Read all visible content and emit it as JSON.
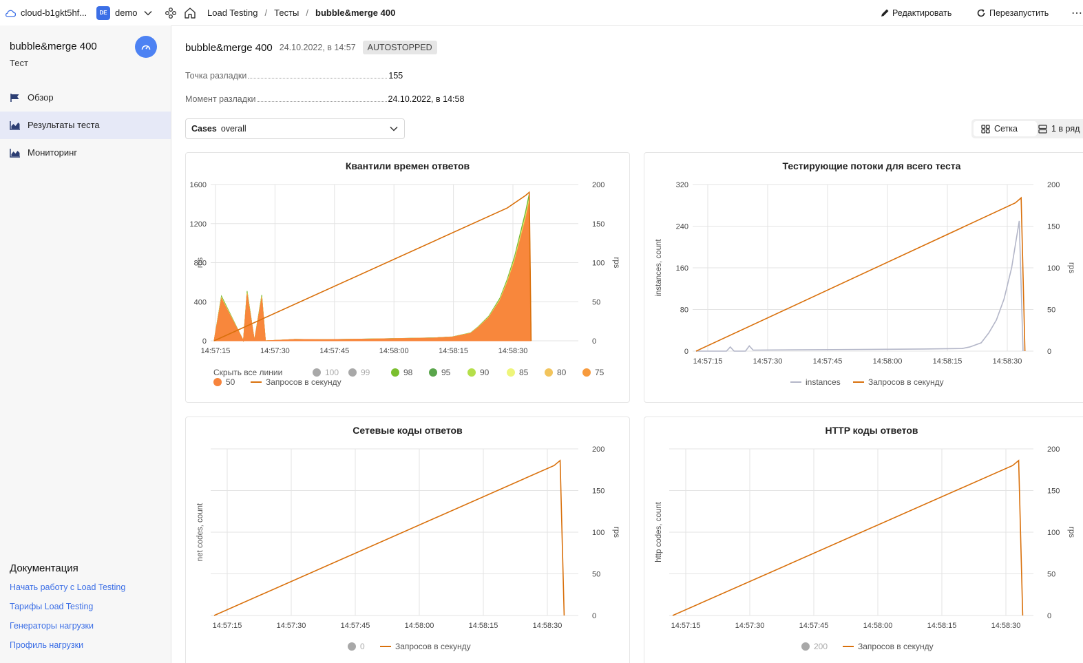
{
  "topbar": {
    "cloud": "cloud-b1gkt5hf...",
    "folder_badge": "DE",
    "folder": "demo",
    "breadcrumbs": [
      "Load Testing",
      "Тесты",
      "bubble&merge 400"
    ],
    "edit_label": "Редактировать",
    "restart_label": "Перезапустить",
    "more_label": "⋯"
  },
  "sidebar": {
    "title": "bubble&merge 400",
    "subtitle": "Тест",
    "items": [
      {
        "label": "Обзор",
        "icon": "flag-icon"
      },
      {
        "label": "Результаты теста",
        "icon": "chart-area-icon",
        "active": true
      },
      {
        "label": "Мониторинг",
        "icon": "chart-mountain-icon"
      }
    ],
    "docs_title": "Документация",
    "docs_links": [
      "Начать работу с Load Testing",
      "Тарифы Load Testing",
      "Генераторы нагрузки",
      "Профиль нагрузки"
    ]
  },
  "test": {
    "name": "bubble&merge 400",
    "date": "24.10.2022, в 14:57",
    "status": "AUTOSTOPPED",
    "fields": [
      {
        "label": "Точка разладки",
        "value": "155"
      },
      {
        "label": "Момент разладки",
        "value": "24.10.2022, в 14:58"
      }
    ]
  },
  "cases": {
    "label": "Cases",
    "value": "overall"
  },
  "view": {
    "grid_label": "Сетка",
    "row_label": "1 в ряд"
  },
  "colors": {
    "rps": "#d9700b",
    "instances": "#b3b6c8",
    "q100": "#a8a8a8",
    "q99": "#a8a8a8",
    "q98": "#7bbf2f",
    "q95": "#5aa54b",
    "q90": "#b5df4a",
    "q85": "#eef57a",
    "q80": "#f2c45c",
    "q75": "#f79a3c",
    "q50": "#f7843c",
    "accent": "#3c6fe6"
  },
  "chart_data": [
    {
      "type": "area",
      "title": "Квантили времен ответов",
      "ylabel": "ms",
      "y2label": "rps",
      "ylim": [
        0,
        1600
      ],
      "y2lim": [
        0,
        200
      ],
      "yticks": [
        "0",
        "400",
        "800",
        "1200",
        "1600"
      ],
      "y2ticks": [
        "0",
        "50",
        "100",
        "150",
        "200"
      ],
      "xticks": [
        "14:57:15",
        "14:57:30",
        "14:57:45",
        "14:58:00",
        "14:58:15",
        "14:58:30"
      ],
      "hide_all_label": "Скрыть все линии",
      "legend": [
        {
          "name": "100",
          "color_key": "q100",
          "muted": true
        },
        {
          "name": "99",
          "color_key": "q99",
          "muted": true
        },
        {
          "name": "98",
          "color_key": "q98"
        },
        {
          "name": "95",
          "color_key": "q95"
        },
        {
          "name": "90",
          "color_key": "q90"
        },
        {
          "name": "85",
          "color_key": "q85"
        },
        {
          "name": "80",
          "color_key": "q80"
        },
        {
          "name": "75",
          "color_key": "q75"
        },
        {
          "name": "50",
          "color_key": "q50"
        },
        {
          "name": "Запросов в секунду",
          "line": true
        }
      ],
      "x_seconds": [
        0,
        2,
        8,
        9,
        11,
        13,
        14,
        20,
        22,
        30,
        45,
        60,
        65,
        70,
        72,
        75,
        78,
        80,
        82,
        84,
        85,
        86,
        86.5
      ],
      "quantile_ms": [
        0,
        450,
        0,
        500,
        0,
        460,
        0,
        10,
        15,
        12,
        20,
        30,
        40,
        80,
        140,
        250,
        430,
        620,
        850,
        1150,
        1300,
        1480,
        0
      ],
      "rps_series": {
        "x_seconds": [
          0,
          80,
          85,
          86,
          86.5
        ],
        "rps": [
          0,
          170,
          186,
          190,
          0
        ]
      }
    },
    {
      "type": "line",
      "title": "Тестирующие потоки для всего теста",
      "ylabel": "instances, count",
      "y2label": "rps",
      "ylim": [
        0,
        320
      ],
      "y2lim": [
        0,
        200
      ],
      "yticks": [
        "0",
        "80",
        "160",
        "240",
        "320"
      ],
      "y2ticks": [
        "0",
        "50",
        "100",
        "150",
        "200"
      ],
      "xticks": [
        "14:57:15",
        "14:57:30",
        "14:57:45",
        "14:58:00",
        "14:58:15",
        "14:58:30"
      ],
      "series": [
        {
          "name": "instances",
          "color_key": "instances",
          "x_seconds": [
            0,
            8,
            9,
            10,
            13,
            14,
            15,
            40,
            60,
            70,
            72,
            75,
            77,
            79,
            81,
            83,
            85,
            86
          ],
          "values": [
            0,
            0,
            8,
            0,
            0,
            10,
            2,
            3,
            4,
            5,
            8,
            16,
            35,
            60,
            100,
            160,
            250,
            0
          ]
        },
        {
          "name": "Запросов в секунду",
          "color_key": "rps",
          "x_seconds": [
            0,
            84,
            85.5,
            86.5
          ],
          "values": [
            0,
            178,
            184,
            0
          ]
        }
      ]
    },
    {
      "type": "line",
      "title": "Сетевые коды ответов",
      "ylabel": "net codes, count",
      "y2label": "rps",
      "y2lim": [
        0,
        200
      ],
      "y2ticks": [
        "0",
        "50",
        "100",
        "150",
        "200"
      ],
      "xticks": [
        "14:57:15",
        "14:57:30",
        "14:57:45",
        "14:58:00",
        "14:58:15",
        "14:58:30"
      ],
      "legend": [
        {
          "name": "0",
          "color_key": "q100",
          "muted": true
        },
        {
          "name": "Запросов в секунду",
          "line": true
        }
      ],
      "rps_series": {
        "x_seconds": [
          0,
          84,
          85.5,
          86.5
        ],
        "rps": [
          0,
          180,
          186,
          0
        ]
      }
    },
    {
      "type": "line",
      "title": "HTTP коды ответов",
      "ylabel": "http codes, count",
      "y2label": "rps",
      "y2lim": [
        0,
        200
      ],
      "y2ticks": [
        "0",
        "50",
        "100",
        "150",
        "200"
      ],
      "xticks": [
        "14:57:15",
        "14:57:30",
        "14:57:45",
        "14:58:00",
        "14:58:15",
        "14:58:30"
      ],
      "legend": [
        {
          "name": "200",
          "color_key": "q100",
          "muted": true
        },
        {
          "name": "Запросов в секунду",
          "line": true
        }
      ],
      "rps_series": {
        "x_seconds": [
          0,
          84,
          85.5,
          86.5
        ],
        "rps": [
          0,
          180,
          186,
          0
        ]
      }
    }
  ]
}
